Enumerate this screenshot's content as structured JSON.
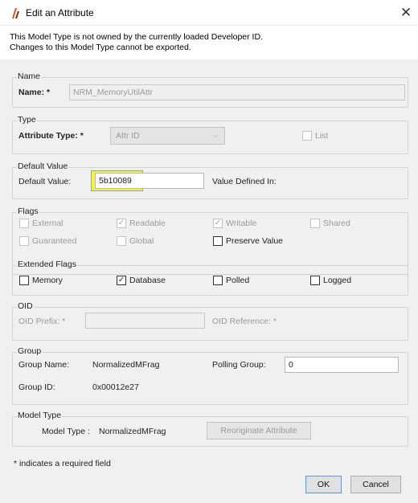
{
  "window": {
    "title": "Edit an Attribute",
    "close_glyph": "✕"
  },
  "notice": {
    "line1": "This Model Type is not owned by the currently loaded Developer ID.",
    "line2": "Changes to this Model Type cannot be exported."
  },
  "name_group": {
    "legend": "Name",
    "label": "Name: *",
    "value": "NRM_MemoryUtilAttr"
  },
  "type_group": {
    "legend": "Type",
    "label": "Attribute Type: *",
    "value": "Attr ID",
    "list_label": "List",
    "list_checked": false
  },
  "default_group": {
    "legend": "Default Value",
    "label": "Default Value:",
    "value": "5b10089",
    "defined_in_label": "Value Defined In:"
  },
  "flags": {
    "legend": "Flags",
    "items": [
      {
        "label": "External",
        "checked": false,
        "enabled": false
      },
      {
        "label": "Readable",
        "checked": true,
        "enabled": false
      },
      {
        "label": "Writable",
        "checked": true,
        "enabled": false
      },
      {
        "label": "Shared",
        "checked": false,
        "enabled": false
      },
      {
        "label": "Guaranteed",
        "checked": false,
        "enabled": false
      },
      {
        "label": "Global",
        "checked": false,
        "enabled": false
      },
      {
        "label": "Preserve Value",
        "checked": false,
        "enabled": true
      }
    ]
  },
  "extended_flags": {
    "legend": "Extended Flags",
    "items": [
      {
        "label": "Memory",
        "checked": false
      },
      {
        "label": "Database",
        "checked": true
      },
      {
        "label": "Polled",
        "checked": false
      },
      {
        "label": "Logged",
        "checked": false
      }
    ]
  },
  "oid": {
    "legend": "OID",
    "prefix_label": "OID Prefix: *",
    "prefix_value": "",
    "reference_label": "OID Reference: *"
  },
  "group": {
    "legend": "Group",
    "name_label": "Group Name:",
    "name_value": "NormalizedMFrag",
    "polling_label": "Polling Group:",
    "polling_value": "0",
    "id_label": "Group ID:",
    "id_value": "0x00012e27"
  },
  "model_type": {
    "legend": "Model Type",
    "label": "Model Type :",
    "value": "NormalizedMFrag",
    "button": "Reoriginate Attribute"
  },
  "footer": {
    "required_note": "* indicates a required field",
    "ok": "OK",
    "cancel": "Cancel"
  },
  "check_glyph": "✓",
  "colors": {
    "highlight": "#f7f23a",
    "dialog_bg": "#f0f0f0"
  }
}
